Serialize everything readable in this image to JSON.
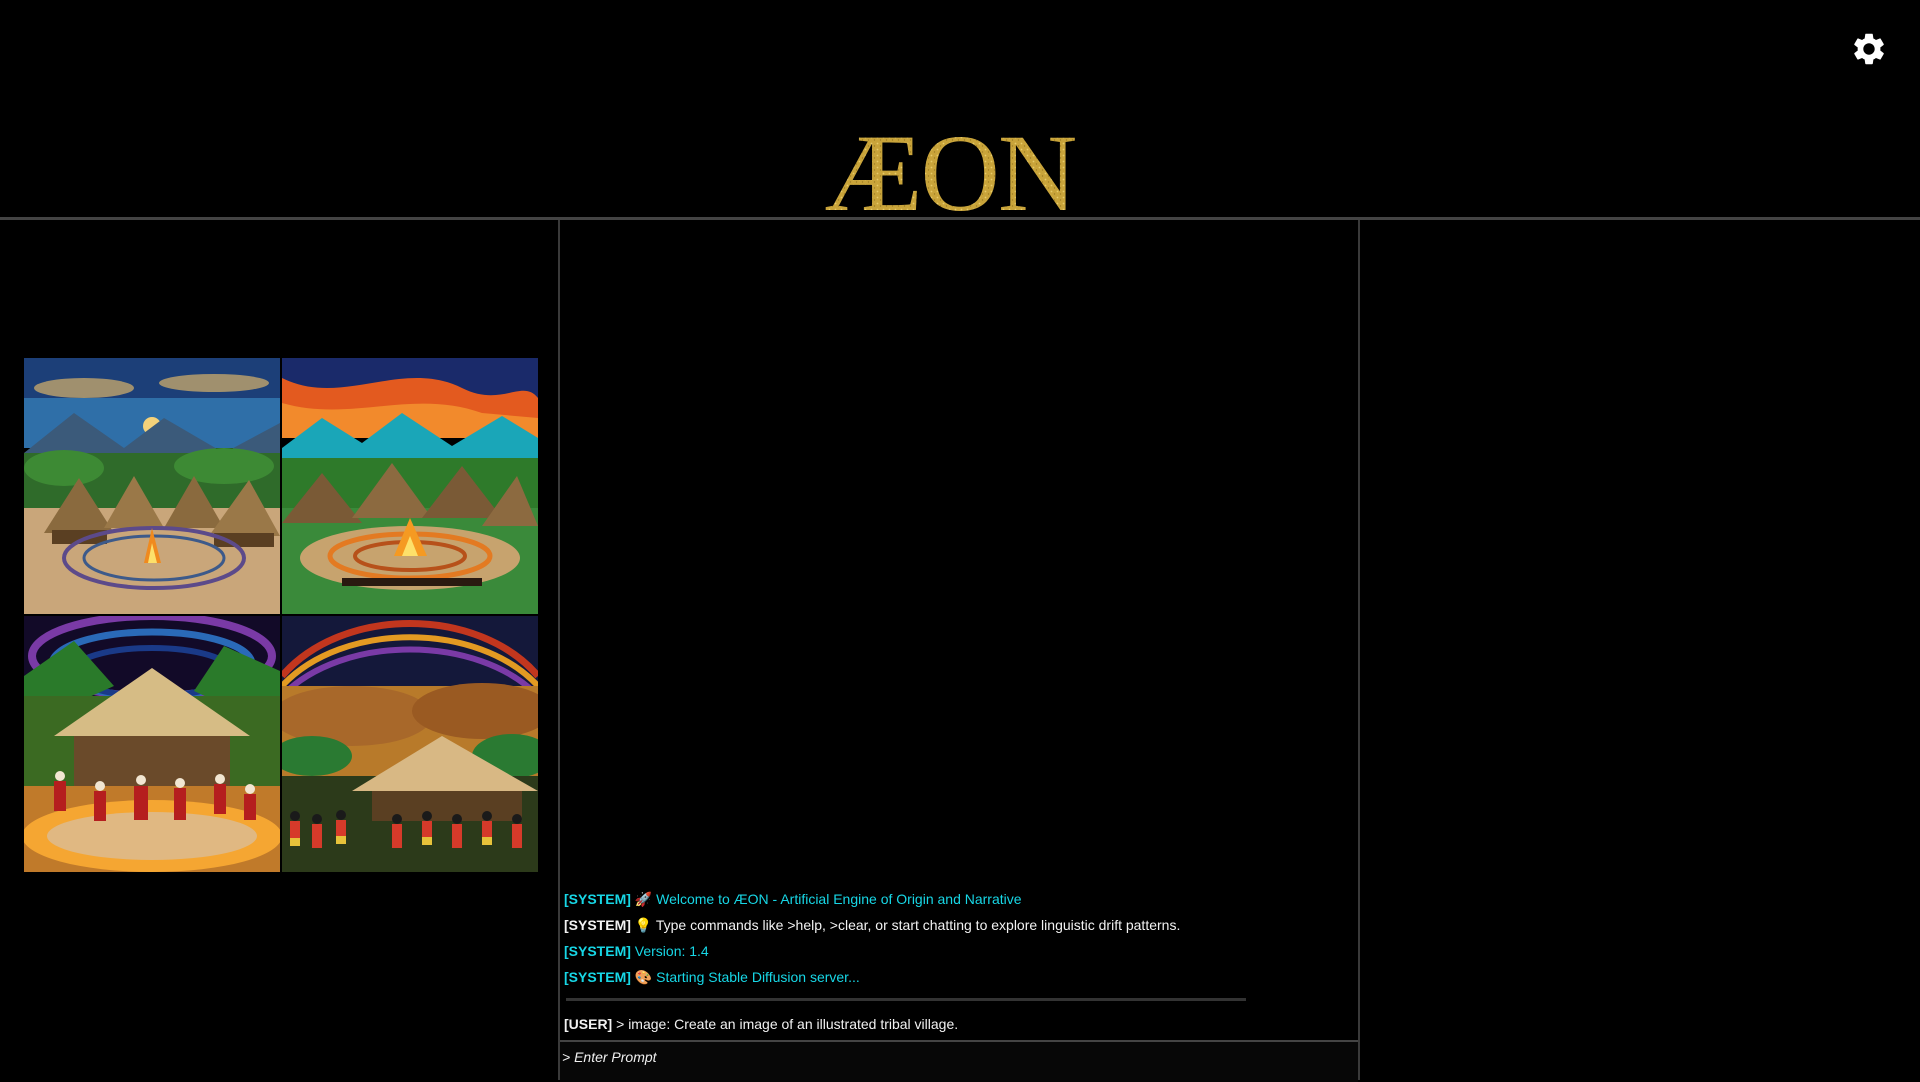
{
  "app": {
    "logo_text": "ÆON",
    "logo_color": "#c9a43a"
  },
  "header": {
    "settings_icon": "gear-icon"
  },
  "gallery": {
    "images": [
      {
        "name": "village-image-1",
        "description_icon": "tribal-village-fire-huts"
      },
      {
        "name": "village-image-2",
        "description_icon": "tribal-village-orange-sky"
      },
      {
        "name": "village-image-3",
        "description_icon": "tribal-village-dancers-hut"
      },
      {
        "name": "village-image-4",
        "description_icon": "tribal-village-rainbow-dancers"
      }
    ]
  },
  "console": {
    "lines": [
      {
        "tag": "[SYSTEM]",
        "emoji": "🚀",
        "text": "Welcome to ÆON - Artificial Engine of Origin and Narrative",
        "color": "#17d7e6"
      },
      {
        "tag": "[SYSTEM]",
        "emoji": "💡",
        "text": "Type commands like >help, >clear, or start chatting to explore linguistic drift patterns.",
        "color": "#f2f2f2"
      },
      {
        "tag": "[SYSTEM]",
        "emoji": "",
        "text": "Version: 1.4",
        "color": "#17d7e6"
      },
      {
        "tag": "[SYSTEM]",
        "emoji": "🎨",
        "text": "Starting Stable Diffusion server...",
        "color": "#17d7e6"
      }
    ],
    "user_line": {
      "tag": "[USER]",
      "text": "> image: Create an image of an illustrated tribal village."
    },
    "input_placeholder": "> Enter Prompt",
    "input_value": ""
  }
}
